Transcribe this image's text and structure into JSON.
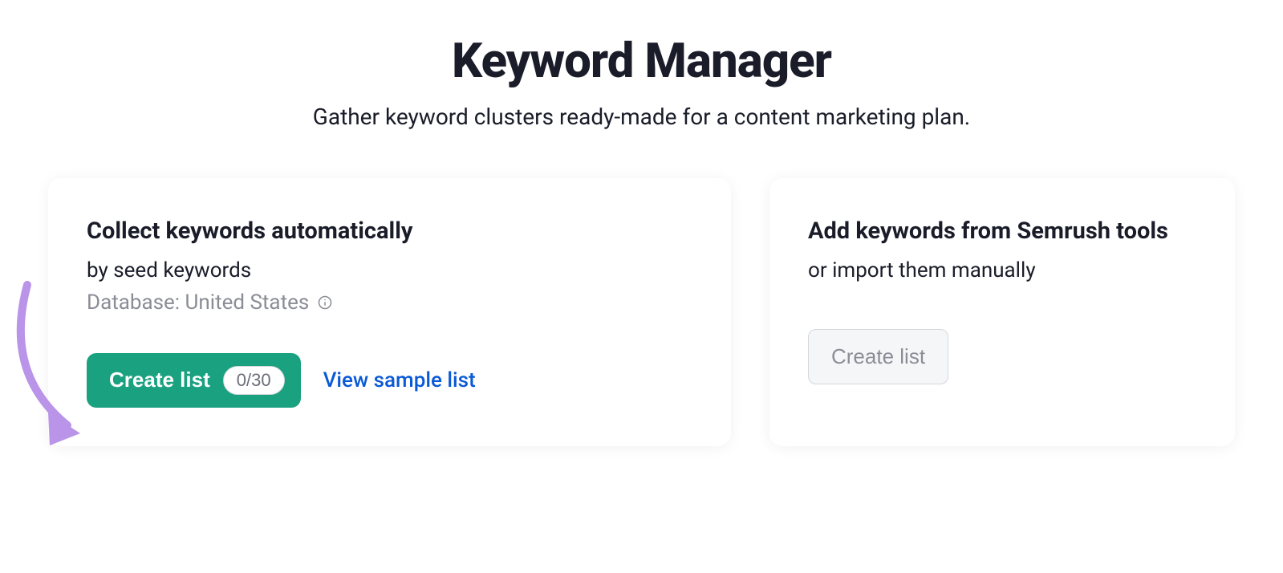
{
  "header": {
    "title": "Keyword Manager",
    "subtitle": "Gather keyword clusters ready-made for a content marketing plan."
  },
  "cards": {
    "left": {
      "title": "Collect keywords automatically",
      "subtitle": "by seed keywords",
      "database_text": "Database: United States",
      "create_button_label": "Create list",
      "create_button_badge": "0/30",
      "sample_link_label": "View sample list"
    },
    "right": {
      "title": "Add keywords from Semrush tools",
      "subtitle": "or import them manually",
      "create_button_label": "Create list"
    }
  },
  "colors": {
    "primary_button": "#1aa17f",
    "link": "#0a59d6",
    "text_muted": "#8b8d96",
    "annotation": "#b994e8"
  }
}
